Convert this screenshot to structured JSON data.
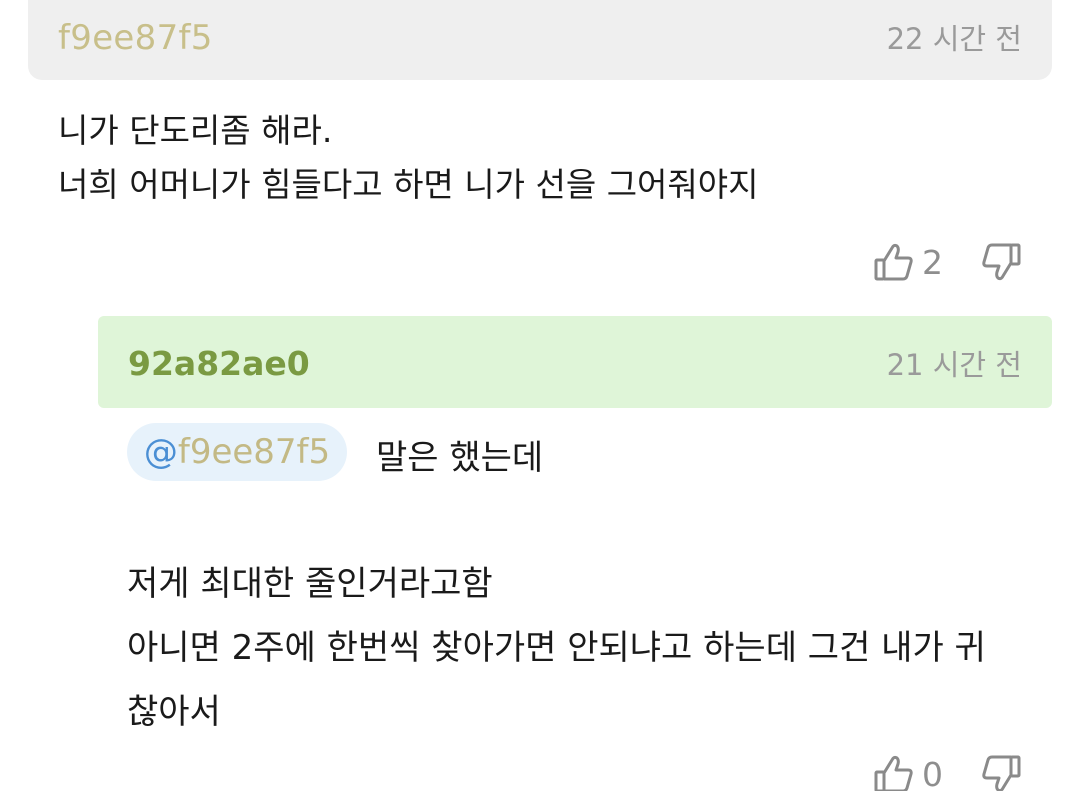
{
  "comment": {
    "username": "f9ee87f5",
    "time": "22 시간 전",
    "lines": [
      "니가 단도리좀 해라.",
      "너희 어머니가 힘들다고 하면 니가 선을 그어줘야지"
    ],
    "likes": "2",
    "icons": [
      "thumb-up-icon",
      "thumb-down-icon"
    ]
  },
  "reply": {
    "username": "92a82ae0",
    "time": "21 시간 전",
    "mention_at": "@",
    "mention_user": "f9ee87f5",
    "first_line": "말은 했는데",
    "lines": [
      "저게 최대한 줄인거라고함",
      "아니면 2주에 한번씩 찾아가면 안되냐고 하는데 그건 내가 귀",
      "찮아서"
    ],
    "likes": "0"
  },
  "colors": {
    "comment_header_bg": "#efefef",
    "reply_header_bg": "#dff5d8",
    "mention_bg": "#e7f2fb",
    "username_comment": "#c8bf8a",
    "username_reply": "#7a9a42",
    "mention_at": "#4b8fd4"
  }
}
